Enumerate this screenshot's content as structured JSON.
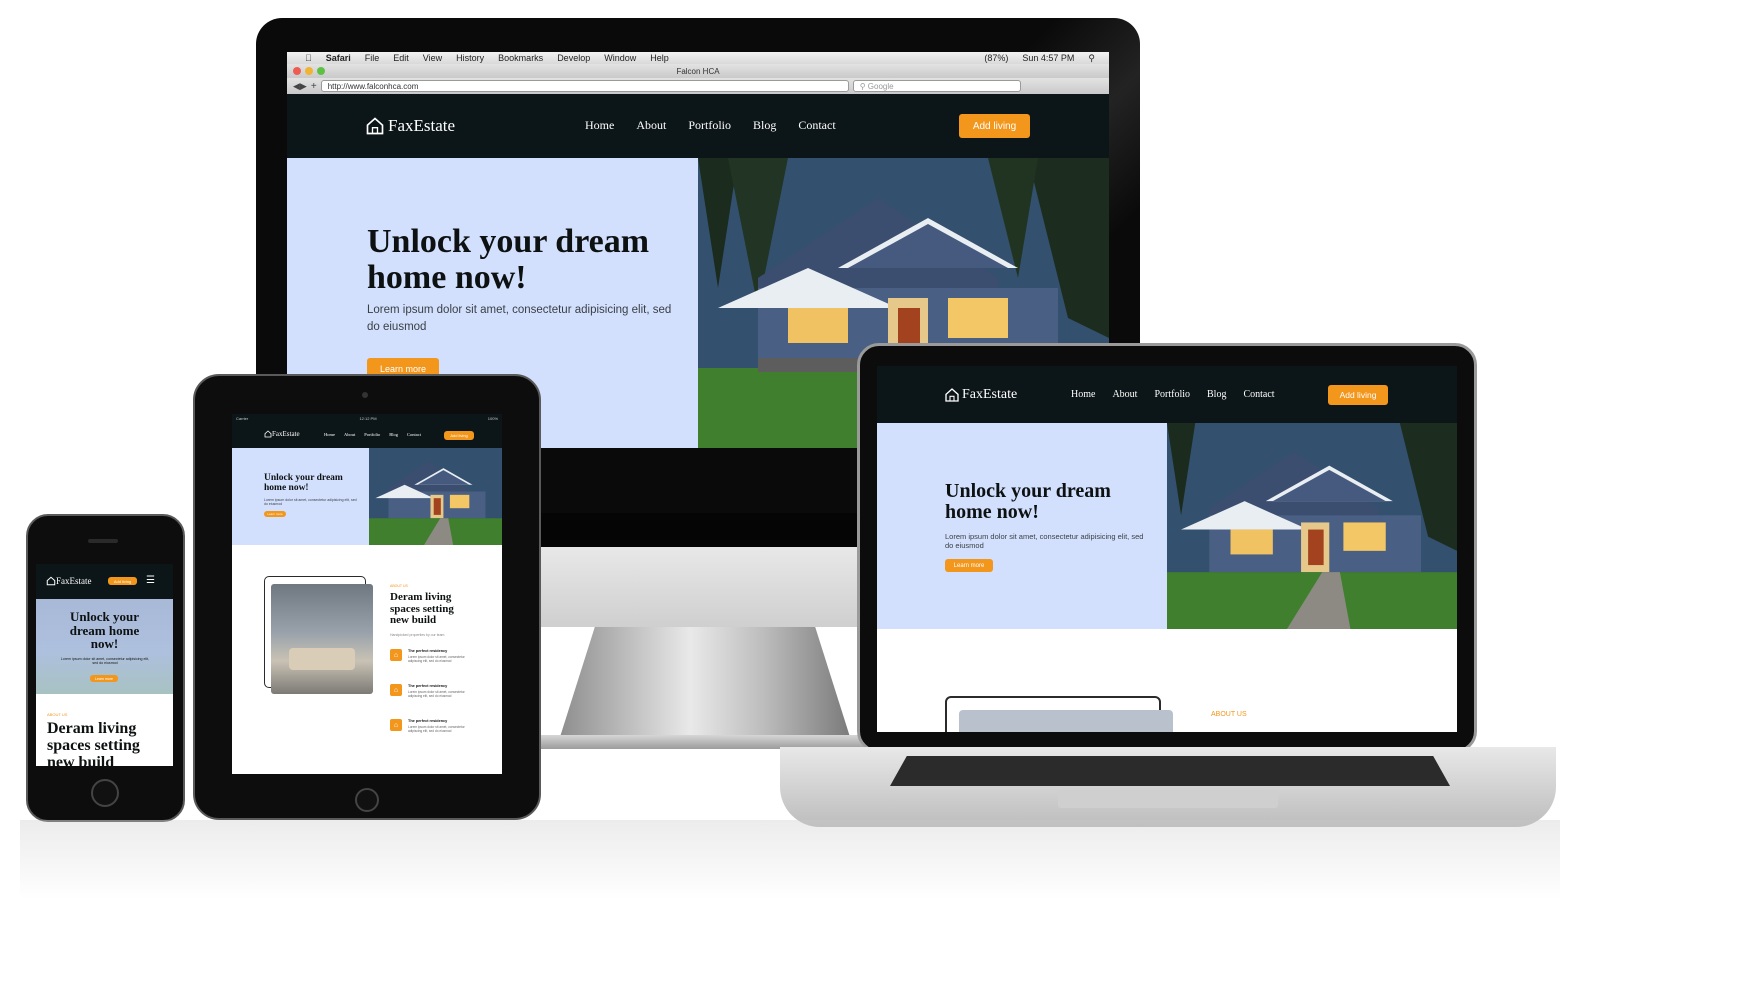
{
  "brand": {
    "name": "FaxEstate",
    "accent": "#f2961c",
    "nav_bg": "#0c1517",
    "hero_bg": "#d2e0fd"
  },
  "nav": {
    "items": [
      "Home",
      "About",
      "Portfolio",
      "Blog",
      "Contact"
    ],
    "cta": "Add living"
  },
  "hero": {
    "title": "Unlock your dream home now!",
    "text": "Lorem ipsum dolor sit amet, consectetur adipisicing elit, sed do eiusmod",
    "button": "Learn more"
  },
  "about": {
    "tag": "ABOUT US",
    "title": "Deram living spaces setting new build",
    "subtitle": "Handpicked properties by our team",
    "features": [
      {
        "title": "The perfect residency",
        "text": "Lorem ipsum dolor sit amet, consectetur adipiscing elit, sed do eiusmod"
      },
      {
        "title": "The perfect residency",
        "text": "Lorem ipsum dolor sit amet, consectetur adipiscing elit, sed do eiusmod"
      },
      {
        "title": "The perfect residency",
        "text": "Lorem ipsum dolor sit amet, consectetur adipiscing elit, sed do eiusmod"
      }
    ]
  },
  "browser": {
    "app": "Safari",
    "menus": [
      "File",
      "Edit",
      "View",
      "History",
      "Bookmarks",
      "Develop",
      "Window",
      "Help"
    ],
    "title": "Falcon HCA",
    "url": "http://www.falconhca.com",
    "search_placeholder": "Google",
    "status_battery": "(87%)",
    "status_time": "Sun 4:57 PM"
  },
  "tablet_status": {
    "carrier": "Carrier",
    "time": "12:12 PM",
    "battery": "100%"
  }
}
